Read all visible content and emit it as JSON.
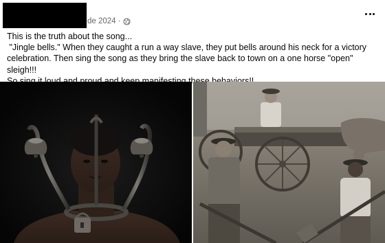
{
  "post": {
    "meta": {
      "date_text": "de 2024 ·",
      "audience_icon": "globe-icon"
    },
    "more_icon": "more-horizontal-icon",
    "text_lines": [
      "This is the truth about the song...",
      " \"Jingle bells.\" When they caught a run a way slave, they put bells around his neck for a victory",
      "celebration. Then sing the song as they bring the slave back to town on a one horse \"open\" sleigh!!!",
      "So sing it loud and proud and keep manifesting these behaviors!!"
    ]
  },
  "media": {
    "photos": [
      {
        "kind": "photo",
        "subject": "man wearing iron collar with bells"
      },
      {
        "kind": "photo",
        "subject": "sepia photo of workers with shovels and a horse wagon"
      }
    ]
  },
  "colors": {
    "text": "#050505",
    "meta_text": "#65676b",
    "redaction": "#000000"
  }
}
